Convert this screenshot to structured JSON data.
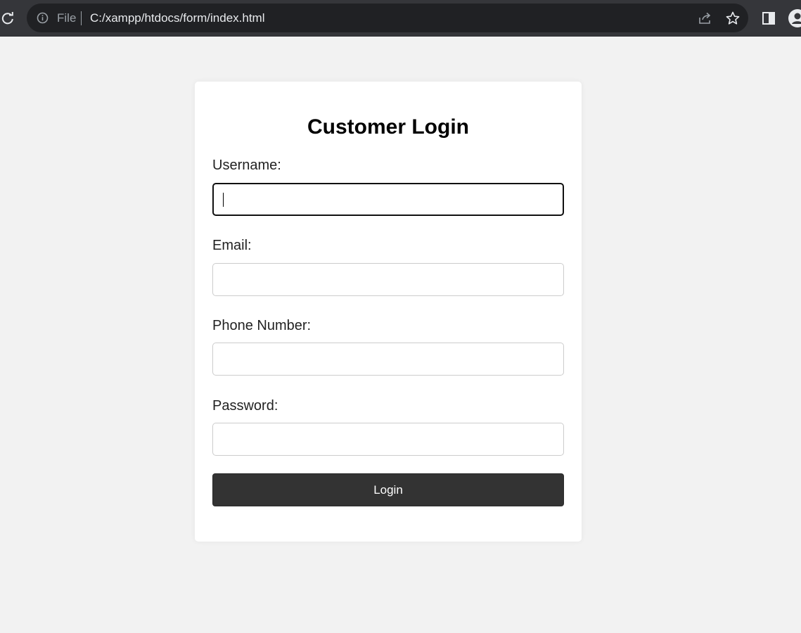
{
  "browser": {
    "scheme_label": "File",
    "url": "C:/xampp/htdocs/form/index.html",
    "icons": [
      "reload-icon",
      "info-icon",
      "share-icon",
      "star-icon",
      "side-panel-icon",
      "profile-icon"
    ]
  },
  "form": {
    "title": "Customer Login",
    "fields": [
      {
        "label": "Username:",
        "value": "",
        "placeholder": "",
        "focused": true
      },
      {
        "label": "Email:",
        "value": "",
        "placeholder": ""
      },
      {
        "label": "Phone Number:",
        "value": "",
        "placeholder": ""
      },
      {
        "label": "Password:",
        "value": "",
        "placeholder": ""
      }
    ],
    "submit_label": "Login"
  },
  "colors": {
    "page_background": "#f2f2f2",
    "card_background": "#ffffff",
    "button_background": "#333333",
    "button_text": "#ffffff",
    "toolbar": "#35363a"
  }
}
